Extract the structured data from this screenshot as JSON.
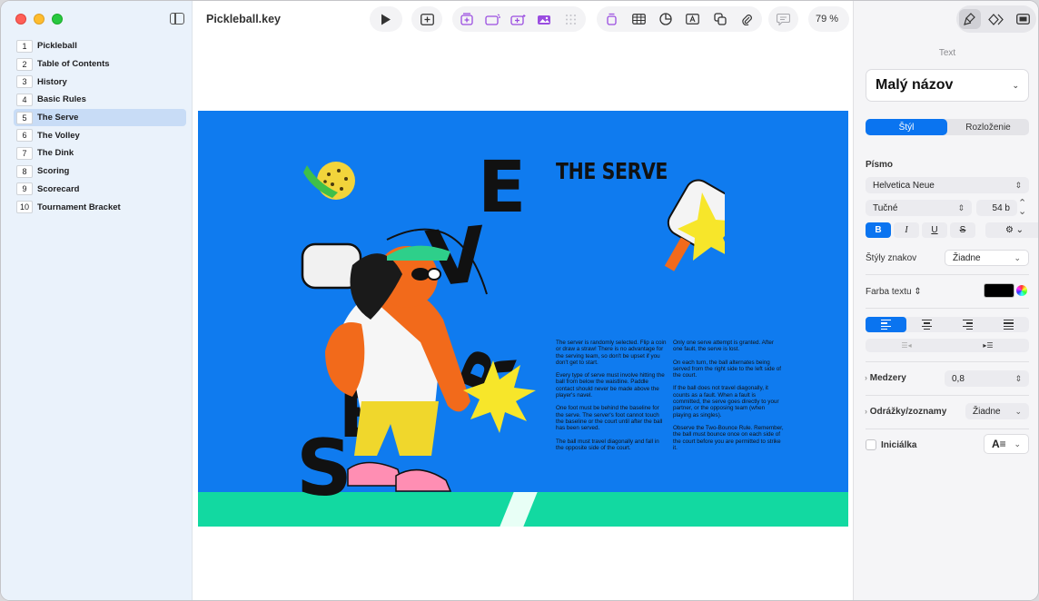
{
  "window": {
    "title": "Pickleball.key"
  },
  "sidebar": {
    "slides": [
      {
        "num": "1",
        "title": "Pickleball"
      },
      {
        "num": "2",
        "title": "Table of Contents"
      },
      {
        "num": "3",
        "title": "History"
      },
      {
        "num": "4",
        "title": "Basic Rules"
      },
      {
        "num": "5",
        "title": "The Serve",
        "selected": true
      },
      {
        "num": "6",
        "title": "The Volley"
      },
      {
        "num": "7",
        "title": "The Dink"
      },
      {
        "num": "8",
        "title": "Scoring"
      },
      {
        "num": "9",
        "title": "Scorecard"
      },
      {
        "num": "10",
        "title": "Tournament Bracket"
      }
    ]
  },
  "toolbar": {
    "zoom": "79 %",
    "icons": [
      "play-icon",
      "add-slide-icon",
      "table-icon",
      "chart-icon",
      "text-icon",
      "shape-icon",
      "media-icon",
      "comment-icon",
      "share-icon"
    ]
  },
  "slide": {
    "title": "THE SERVE",
    "letters": {
      "e1": "E",
      "v": "V",
      "r": "R",
      "e2": "E",
      "s": "S"
    },
    "col1": [
      "The server is randomly selected. Flip a coin or draw a straw! There is no advantage for the serving team, so don't be upset if you don't get to start.",
      "Every type of serve must involve hitting the ball from below the waistline. Paddle contact should never be made above the player's navel.",
      "One foot must be behind the baseline for the serve. The server's foot cannot touch the baseline or the court until after the ball has been served.",
      "The ball must travel diagonally and fall in the opposite side of the court."
    ],
    "col2": [
      "Only one serve attempt is granted. After one fault, the serve is lost.",
      "On each turn, the ball alternates being served from the right side to the left side of the court.",
      "If the ball does not travel diagonally, it counts as a fault. When a fault is committed, the serve goes directly to your partner, or the opposing team (when playing as singles).",
      "Observe the Two-Bounce Rule. Remember, the ball must bounce once on each side of the court before you are permitted to strike it."
    ]
  },
  "inspector": {
    "section": "Text",
    "paragraph_style": "Malý názov",
    "tabs": {
      "style": "Štýl",
      "layout": "Rozloženie"
    },
    "font_label": "Písmo",
    "font_family": "Helvetica Neue",
    "font_weight": "Tučné",
    "font_size": "54 b",
    "format": {
      "bold": "B",
      "italic": "I",
      "underline": "U",
      "strike": "S"
    },
    "char_styles_label": "Štýly znakov",
    "char_styles_value": "Žiadne",
    "text_color_label": "Farba textu",
    "text_color": "#000000",
    "spacing_label": "Medzery",
    "spacing_value": "0,8",
    "bullets_label": "Odrážky/zoznamy",
    "bullets_value": "Žiadne",
    "dropcap_label": "Iniciálka"
  },
  "colors": {
    "accent": "#0a74f0",
    "slide_bg": "#0f7bef",
    "ground": "#12d9a1"
  }
}
